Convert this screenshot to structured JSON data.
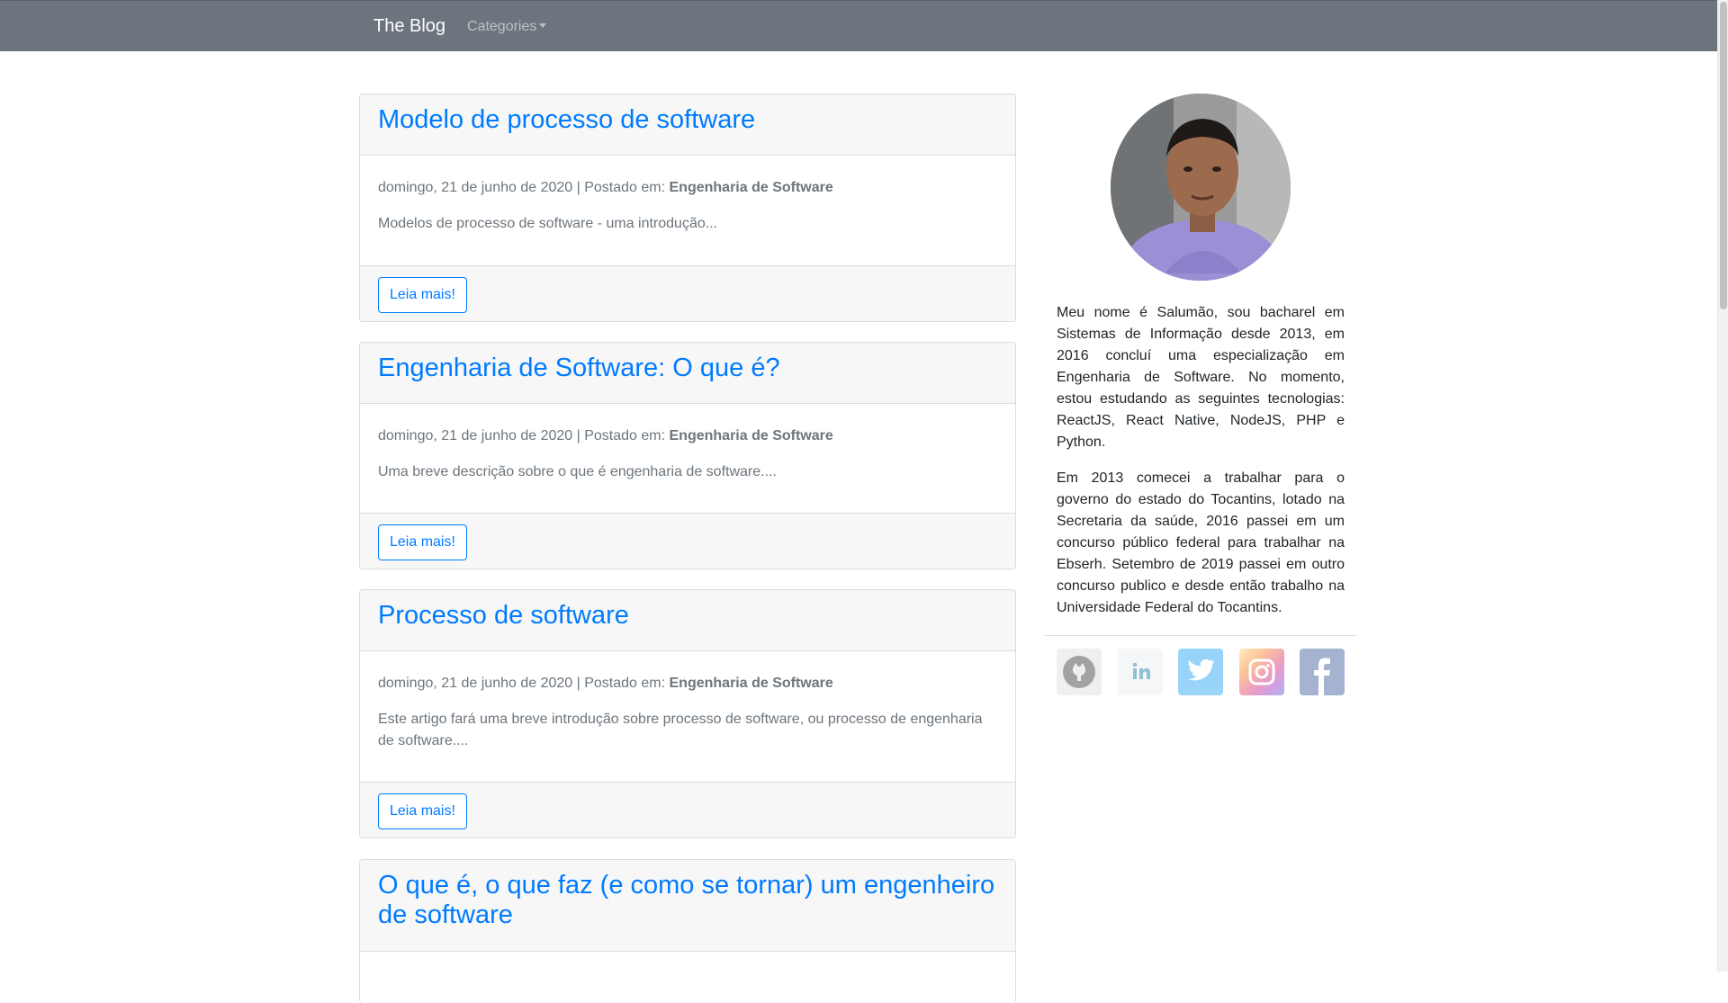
{
  "navbar": {
    "brand": "The Blog",
    "categories_label": "Categories"
  },
  "posts": [
    {
      "title": "Modelo de processo de software",
      "date_prefix": "domingo, 21 de junho de 2020 | Postado em: ",
      "category": "Engenharia de Software",
      "excerpt": "Modelos de processo de software - uma introdução...",
      "button_label": "Leia mais!"
    },
    {
      "title": "Engenharia de Software: O que é?",
      "date_prefix": "domingo, 21 de junho de 2020 | Postado em: ",
      "category": "Engenharia de Software",
      "excerpt": "Uma breve descrição sobre o que é engenharia de software....",
      "button_label": "Leia mais!"
    },
    {
      "title": "Processo de software",
      "date_prefix": "domingo, 21 de junho de 2020 | Postado em: ",
      "category": "Engenharia de Software",
      "excerpt": "Este artigo fará uma breve introdução sobre processo de software, ou processo de engenharia de software....",
      "button_label": "Leia mais!"
    },
    {
      "title": "O que é, o que faz (e como se tornar) um engenheiro de software"
    }
  ],
  "sidebar": {
    "bio_paragraph_1": "Meu nome é Salumão, sou bacharel em Sistemas de Informação desde 2013, em 2016 concluí uma especialização em Engenharia de Software. No momento, estou estudando as seguintes tecnologias: ReactJS, React Native, NodeJS, PHP e Python.",
    "bio_paragraph_2": "Em 2013 comecei a trabalhar para o governo do estado do Tocantins, lotado na Secretaria da saúde, 2016 passei em um concurso público federal para trabalhar na Ebserh. Setembro de 2019 passei em outro concurso publico e desde então trabalho na Universidade Federal do Tocantins.",
    "social": [
      {
        "icon": "github-icon",
        "color": "#333333"
      },
      {
        "icon": "linkedin-icon",
        "color": "#0e76a8"
      },
      {
        "icon": "twitter-icon",
        "color": "#1da1f2"
      },
      {
        "icon": "instagram-icon",
        "color": "#e1306c"
      },
      {
        "icon": "facebook-icon",
        "color": "#3b5998"
      }
    ]
  },
  "colors": {
    "navbar_bg": "#6c757d",
    "link": "#007bff",
    "muted": "#6c757d"
  }
}
